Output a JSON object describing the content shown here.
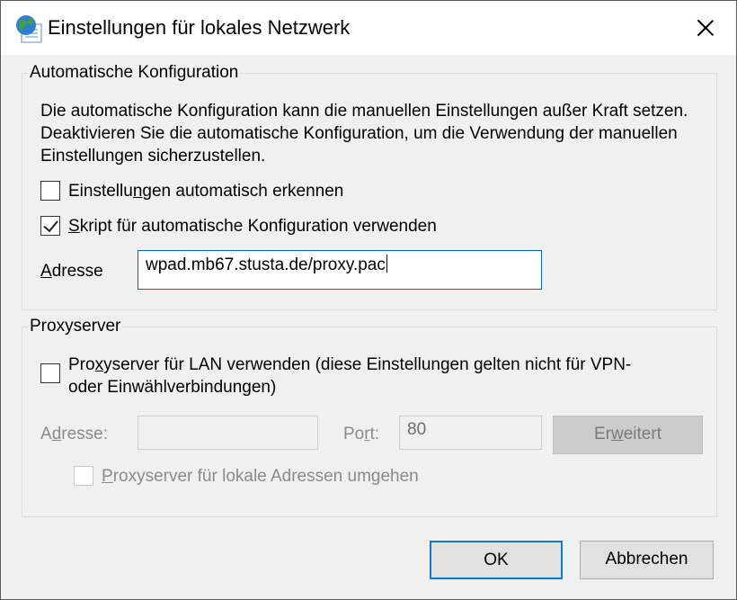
{
  "window": {
    "title": "Einstellungen für lokales Netzwerk",
    "close_glyph": "X"
  },
  "auto_config": {
    "legend": "Automatische Konfiguration",
    "description": "Die automatische Konfiguration kann die manuellen Einstellungen außer Kraft setzen. Deaktivieren Sie die automatische Konfiguration, um die Verwendung der manuellen Einstellungen sicherzustellen.",
    "auto_detect": {
      "label_pre": "Einstellu",
      "label_u": "n",
      "label_post": "gen automatisch erkennen",
      "checked": false
    },
    "use_script": {
      "label_pre": "",
      "label_u": "S",
      "label_post": "kript für automatische Konfiguration verwenden",
      "checked": true
    },
    "address": {
      "label_u": "A",
      "label_post": "dresse",
      "value": "wpad.mb67.stusta.de/proxy.pac"
    }
  },
  "proxy": {
    "legend": "Proxyserver",
    "use_proxy": {
      "label_line1_pre": "Pro",
      "label_line1_u": "x",
      "label_line1_post": "yserver für LAN verwenden (diese Einstellungen gelten nicht für VPN-",
      "label_line2": "oder Einwählverbindungen)",
      "checked": false
    },
    "address_label_pre": "A",
    "address_label_u": "d",
    "address_label_post": "resse:",
    "address_value": "",
    "port_label_pre": "Po",
    "port_label_u": "r",
    "port_label_post": "t:",
    "port_value": "80",
    "advanced_pre": "Er",
    "advanced_u": "w",
    "advanced_post": "eitert",
    "bypass": {
      "label_u": "P",
      "label_post": "roxyserver für lokale Adressen umgehen",
      "checked": false
    }
  },
  "buttons": {
    "ok": "OK",
    "cancel": "Abbrechen"
  },
  "colors": {
    "accent": "#0a78d7",
    "input_border": "#0a63c9",
    "background": "#f0f0f0"
  },
  "icons": {
    "title": "globe-network-icon"
  }
}
